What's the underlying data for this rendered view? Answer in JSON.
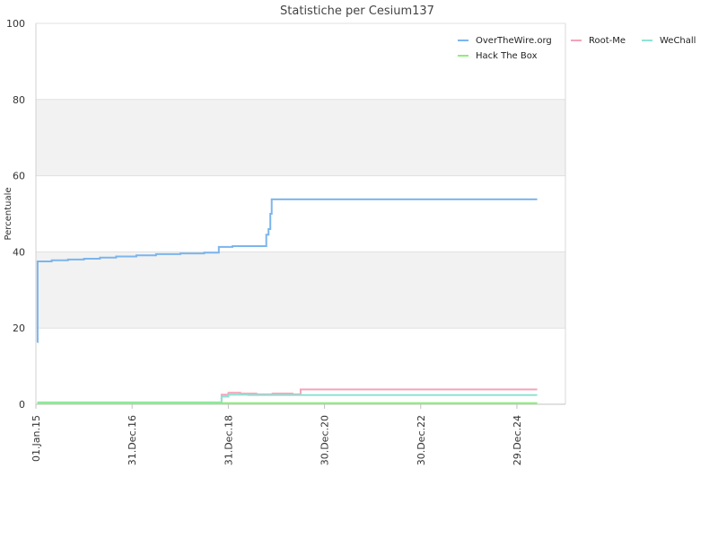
{
  "chart_data": {
    "type": "line",
    "title": "Statistiche per Cesium137",
    "xlabel": "",
    "ylabel": "Percentuale",
    "ylim": [
      0,
      100
    ],
    "xlim": [
      "2015-01-01",
      "2026-01-01"
    ],
    "y_ticks": [
      "0",
      "20",
      "40",
      "60",
      "80",
      "100"
    ],
    "x_ticks": [
      {
        "date": "2015-01-01",
        "label": "01.Jan.15"
      },
      {
        "date": "2016-12-31",
        "label": "31.Dec.16"
      },
      {
        "date": "2018-12-31",
        "label": "31.Dec.18"
      },
      {
        "date": "2020-12-30",
        "label": "30.Dec.20"
      },
      {
        "date": "2022-12-30",
        "label": "30.Dec.22"
      },
      {
        "date": "2024-12-29",
        "label": "29.Dec.24"
      }
    ],
    "grid": true,
    "alternating_bands": true,
    "legend_position": "top-right",
    "series": [
      {
        "name": "OverTheWire.org",
        "color": "#7cb5ec",
        "step": true,
        "points": [
          [
            "2015-01-12",
            16.3
          ],
          [
            "2015-01-14",
            37.5
          ],
          [
            "2015-05-01",
            37.8
          ],
          [
            "2015-09-01",
            38.0
          ],
          [
            "2016-01-01",
            38.2
          ],
          [
            "2016-05-01",
            38.5
          ],
          [
            "2016-09-01",
            38.8
          ],
          [
            "2017-02-01",
            39.1
          ],
          [
            "2017-07-01",
            39.4
          ],
          [
            "2018-01-01",
            39.6
          ],
          [
            "2018-07-01",
            39.8
          ],
          [
            "2018-10-20",
            41.3
          ],
          [
            "2019-02-01",
            41.5
          ],
          [
            "2019-10-15",
            44.5
          ],
          [
            "2019-11-01",
            46.0
          ],
          [
            "2019-11-15",
            50.0
          ],
          [
            "2019-11-25",
            53.8
          ],
          [
            "2025-06-01",
            53.8
          ]
        ]
      },
      {
        "name": "Root-Me",
        "color": "#f4a3b9",
        "step": true,
        "points": [
          [
            "2015-01-12",
            0.4
          ],
          [
            "2018-11-01",
            0.4
          ],
          [
            "2018-11-10",
            2.5
          ],
          [
            "2019-01-01",
            3.0
          ],
          [
            "2019-04-01",
            2.8
          ],
          [
            "2019-08-01",
            2.6
          ],
          [
            "2019-12-01",
            2.8
          ],
          [
            "2020-05-01",
            2.6
          ],
          [
            "2020-07-01",
            3.9
          ],
          [
            "2025-06-01",
            3.9
          ]
        ]
      },
      {
        "name": "WeChall",
        "color": "#8ee3d4",
        "step": true,
        "points": [
          [
            "2015-01-12",
            0.5
          ],
          [
            "2018-11-01",
            0.5
          ],
          [
            "2018-11-10",
            2.0
          ],
          [
            "2019-01-01",
            2.5
          ],
          [
            "2019-06-01",
            2.4
          ],
          [
            "2020-01-01",
            2.4
          ],
          [
            "2025-06-01",
            2.4
          ]
        ]
      },
      {
        "name": "Hack The Box",
        "color": "#90ed7d",
        "step": true,
        "points": [
          [
            "2015-01-12",
            0.3
          ],
          [
            "2025-06-01",
            0.3
          ]
        ]
      }
    ]
  }
}
